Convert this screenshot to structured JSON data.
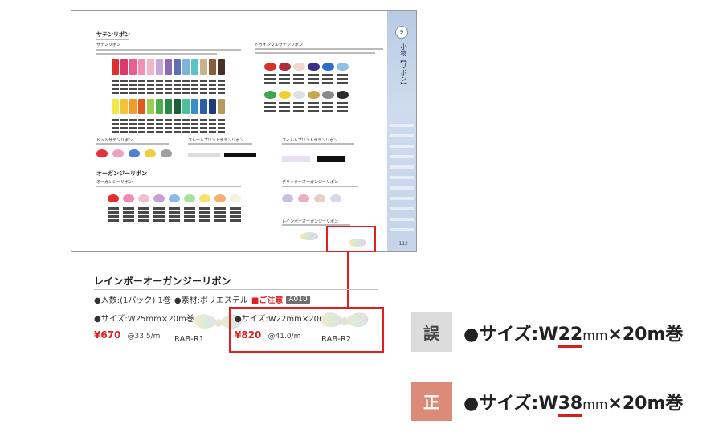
{
  "catalog_page": {
    "section_satin": "サテンリボン",
    "section_satin_sub": "サテンリボン",
    "section_twinkle": "トゥインクルサテンリボン",
    "section_dot": "ドットサテンリボン",
    "section_frame": "フレームプリントサテンリボン",
    "section_film": "フィルムプリントサテンリボン",
    "section_organdy": "オーガンジーリボン",
    "section_organdy_sub": "オーガンジーリボン",
    "section_glitter": "グリッターオーガンジーリボン",
    "section_rainbow": "レインボーオーガンジーリボン",
    "sidebar_badge": "9",
    "sidebar_title": "小物【リボン】",
    "page_number": "112",
    "colors": {
      "satin_row1": [
        "#e0302e",
        "#d83a6a",
        "#ea5d8e",
        "#f28fb4",
        "#f4b2c9",
        "#c9a6d6",
        "#8c6bb1",
        "#5c6fb4",
        "#7fb2dd",
        "#5ec3c4",
        "#c7b28a",
        "#8b5a3a",
        "#4a2f25",
        "#2b2b2b",
        "#b33a2e",
        "#6b1e2e",
        "#e8e1cf"
      ],
      "satin_row2": [
        "#f3e84a",
        "#f5c33b",
        "#f29b2b",
        "#e25a1f",
        "#9bd04d",
        "#4bb04b",
        "#2a8a4a",
        "#1e5e3a",
        "#4ec0a0",
        "#3a8fc8",
        "#2a5ea8",
        "#1e3a7a",
        "#b89a5e",
        "#8a7a6a",
        "#5a5a5a",
        "#1a1a1a",
        "#f2f2f2"
      ],
      "twinkle_row1": [
        "#d9302b",
        "#b52a3a",
        "#f2d8d0",
        "#3a2e8a",
        "#2a6ec8",
        "#8ec0e8",
        "#1e3a6a"
      ],
      "twinkle_row2": [
        "#3aa84a",
        "#f2d22a",
        "#e0e0e0",
        "#c9a650",
        "#8a8a8a",
        "#2a2a2a",
        "#f2f2f2"
      ],
      "organdy": [
        "#e03030",
        "#f58ab0",
        "#f2c0d0",
        "#c8a0d8",
        "#8ab8e8",
        "#a8e0a0",
        "#f5e070",
        "#f5b070",
        "#f5f0e0",
        "#c8c8c8",
        "#8a6a4a",
        "#3a3a3a",
        "#d8c0a0"
      ],
      "glitter": [
        "#c8c0e0",
        "#e8b0c0",
        "#e8d0c8",
        "#d8d8e8",
        "#f0c8c0"
      ],
      "accent_red": "#e0201f"
    }
  },
  "detail": {
    "title": "レインボーオーガンジーリボン",
    "meta_qty": "●入数:(1パック) 1巻",
    "meta_material": "●素材:ポリエステル",
    "meta_notice": "■ご注意",
    "meta_code": "A010",
    "products": [
      {
        "size": "●サイズ:W25mm×20m巻",
        "price": "¥670",
        "unit": "@33.5/m",
        "code": "RAB-R1"
      },
      {
        "size": "●サイズ:W22mm×20m巻",
        "price": "¥820",
        "unit": "@41.0/m",
        "code": "RAB-R2"
      }
    ]
  },
  "correction": {
    "wrong_label": "誤",
    "wrong_prefix": "●サイズ:W",
    "wrong_num": "22",
    "wrong_mm": "mm",
    "wrong_suffix": "×20m巻",
    "right_label": "正",
    "right_prefix": "●サイズ:W",
    "right_num": "38",
    "right_mm": "mm",
    "right_suffix": "×20m巻"
  }
}
